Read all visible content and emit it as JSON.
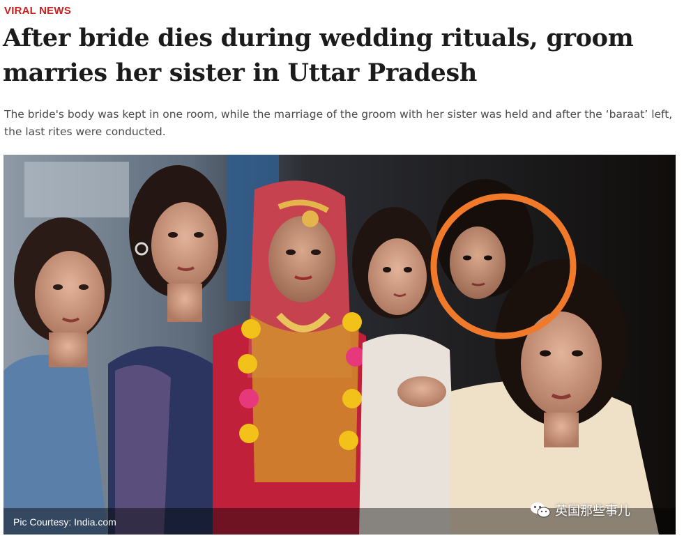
{
  "article": {
    "category": "VIRAL NEWS",
    "headline": "After bride dies during wedding rituals, groom marries her sister in Uttar Pradesh",
    "summary": "The bride's body was kept in one room, while the marriage of the groom with her sister was held and after the ‘baraat’ left, the last rites were conducted."
  },
  "photo": {
    "credit": "Pic Courtesy: India.com",
    "highlight_color": "#f07a2a",
    "watermark": "英国那些事儿",
    "watermark_icon": "wechat-icon"
  },
  "colors": {
    "category": "#c8201e",
    "headline": "#1b1b1b",
    "summary": "#4a4a4a"
  }
}
